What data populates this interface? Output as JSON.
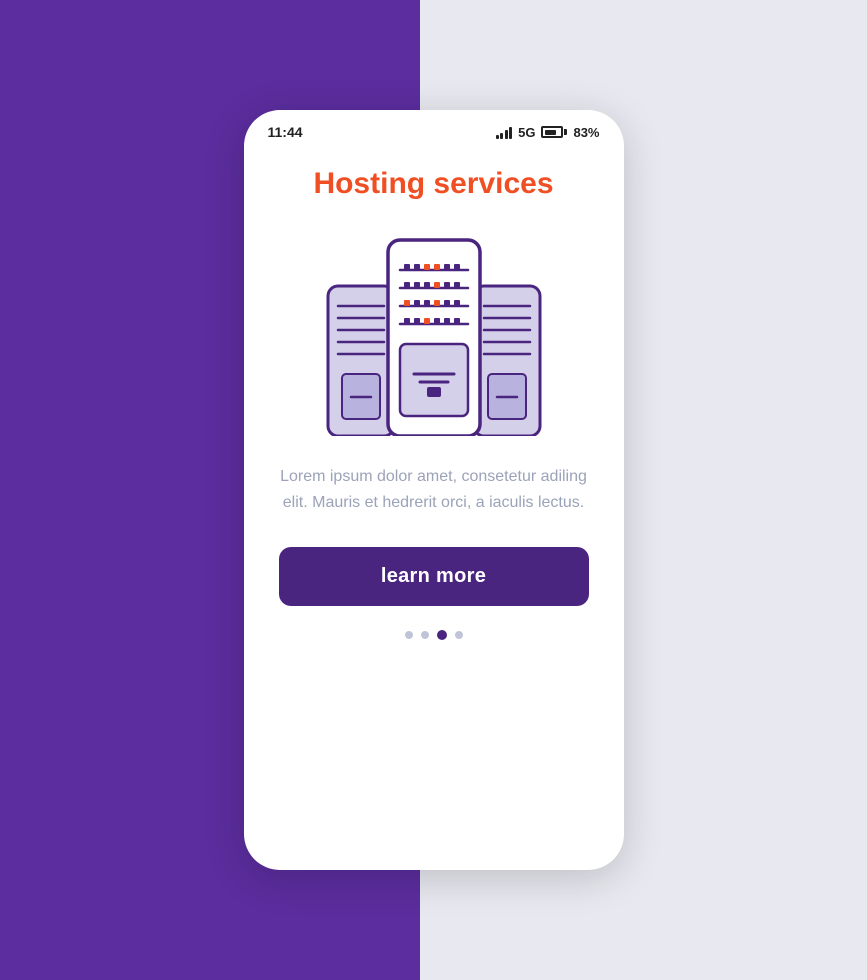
{
  "background": {
    "left_color": "#5b2d9e",
    "right_color": "#e8e8f0"
  },
  "status_bar": {
    "time": "11:44",
    "network": "5G",
    "battery_percent": "83%"
  },
  "content": {
    "title": "Hosting services",
    "description": "Lorem ipsum dolor amet, consetetur adiling elit. Mauris et hedrerit orci, a iaculis lectus.",
    "button_label": "learn more"
  },
  "dots": {
    "count": 4,
    "active_index": 2
  },
  "colors": {
    "title": "#f04e23",
    "button_bg": "#4a2580",
    "button_text": "#ffffff",
    "description": "#9ba3b8",
    "server_primary": "#4a2580",
    "server_secondary": "#d4d0ea",
    "server_accent": "#f04e23"
  }
}
